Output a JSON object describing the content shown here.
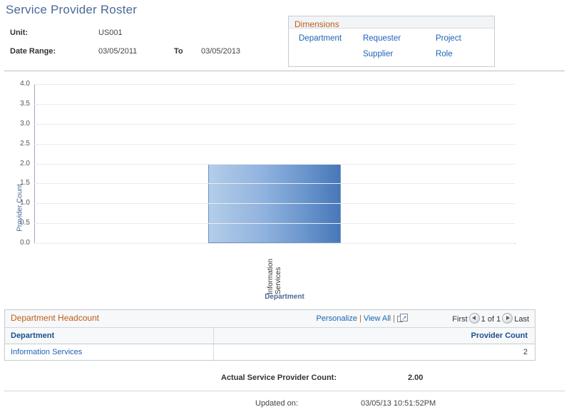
{
  "page": {
    "title": "Service Provider Roster"
  },
  "criteria": {
    "unit_label": "Unit:",
    "unit_value": "US001",
    "date_range_label": "Date Range:",
    "date_from": "03/05/2011",
    "to_label": "To",
    "date_to": "03/05/2013"
  },
  "dimensions": {
    "header": "Dimensions",
    "rows": [
      [
        {
          "label": "Department"
        },
        {
          "label": "Requester"
        },
        {
          "label": "Project"
        }
      ],
      [
        {
          "label": ""
        },
        {
          "label": "Supplier"
        },
        {
          "label": "Role"
        }
      ]
    ]
  },
  "chart_data": {
    "type": "bar",
    "title": "",
    "categories": [
      "Information Services"
    ],
    "values": [
      2
    ],
    "xlabel": "Department",
    "ylabel": "Provider Count",
    "ylim": [
      0.0,
      4.0
    ],
    "ytick_labels": [
      "4.0",
      "3.5",
      "3.0",
      "2.5",
      "2.0",
      "1.5",
      "1.0",
      "0.5",
      "0.0"
    ],
    "ytick_values": [
      4.0,
      3.5,
      3.0,
      2.5,
      2.0,
      1.5,
      1.0,
      0.5,
      0.0
    ],
    "grid": true,
    "legend": "none",
    "bar_color_start": "#b4cdea",
    "bar_color_end": "#4877b8"
  },
  "grid": {
    "title": "Department Headcount",
    "tools": {
      "personalize": "Personalize",
      "view_all": "View All",
      "separator": "|",
      "expand_icon": "expand-to-window-icon"
    },
    "pager": {
      "first": "First",
      "prev_icon": "previous-page-icon",
      "position": "1 of 1",
      "next_icon": "next-page-icon",
      "last": "Last"
    },
    "columns": [
      "Department",
      "Provider Count"
    ],
    "rows": [
      {
        "department": "Information Services",
        "provider_count": "2"
      }
    ]
  },
  "totals": {
    "label": "Actual Service Provider Count:",
    "value": "2.00"
  },
  "footer": {
    "updated_label": "Updated on:",
    "updated_value": "03/05/13 10:51:52PM"
  }
}
